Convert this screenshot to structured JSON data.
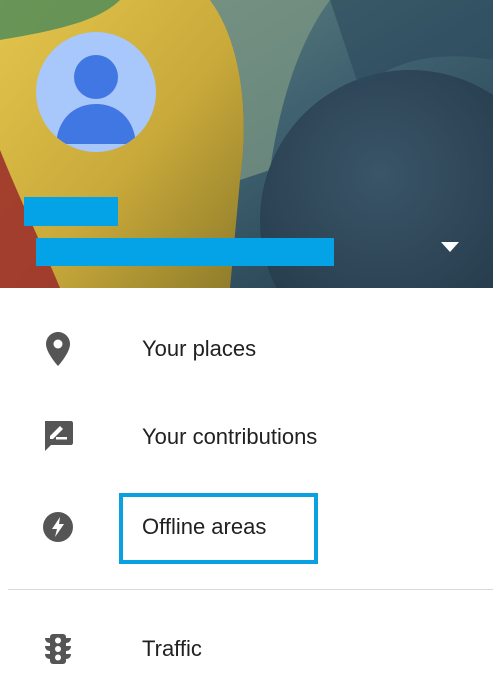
{
  "header": {
    "avatar_icon": "person-avatar-icon",
    "name_redacted": "",
    "email_redacted": "",
    "toggle_icon": "dropdown-triangle-icon"
  },
  "menu": {
    "items": [
      {
        "label": "Your places",
        "icon": "location-pin-icon"
      },
      {
        "label": "Your contributions",
        "icon": "edit-feedback-icon"
      },
      {
        "label": "Offline areas",
        "icon": "offline-bolt-icon"
      },
      {
        "label": "Traffic",
        "icon": "traffic-light-icon"
      }
    ],
    "highlighted_item": "Offline areas"
  },
  "colors": {
    "icon": "#555555",
    "text": "#212121",
    "highlight": "#0aa1e2",
    "redaction": "#04a3e8",
    "avatar_bg": "#a8c7fa",
    "avatar_fg": "#4177e3"
  }
}
